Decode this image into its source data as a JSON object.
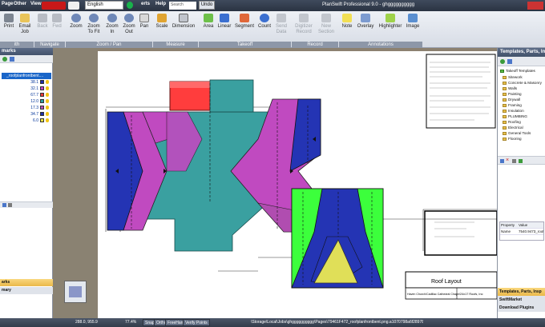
{
  "titlebar": {
    "menu": [
      "Page",
      "Other",
      "View",
      "erts",
      "Help"
    ],
    "language": "English",
    "search_placeholder": "Search",
    "undo_label": "Undo",
    "app_title": "PlanSwift Professional 9.0 - ghgggggggggg"
  },
  "ribbon": {
    "buttons": {
      "print": "Print",
      "email": "Email Job",
      "back": "Back",
      "fwd": "Fwd",
      "zoom": "Zoom",
      "zoom_fit": "Zoom To Fit",
      "zoom_in": "Zoom In",
      "zoom_out": "Zoom Out",
      "pan": "Pan",
      "scale": "Scale",
      "dimension": "Dimension",
      "area": "Area",
      "linear": "Linear",
      "segment": "Segment",
      "count": "Count",
      "send_data": "Send Data",
      "digitizer": "Digitizer Record",
      "new_section": "New Section",
      "note": "Note",
      "overlay": "Overlay",
      "highlighter": "Highlighter",
      "image": "Image"
    },
    "groups": {
      "print": "ith",
      "navigate": "Navigate",
      "zoom_pan": "Zoom / Pan",
      "measure": "Measure",
      "takeoff": "Takeoff",
      "record": "Record",
      "annotations": "Annotations"
    }
  },
  "left_panel": {
    "title": "marks",
    "tree_root": "_roofplanfrontbent....",
    "rows": [
      {
        "value": "38.1",
        "color": "#1e2ca6"
      },
      {
        "value": "32.1",
        "color": "#c040c0"
      },
      {
        "value": "67.7",
        "color": "#e63a3a"
      },
      {
        "value": "12.0",
        "color": "#2da0a0"
      },
      {
        "value": "17.3",
        "color": "#b04db0"
      },
      {
        "value": "34.7",
        "color": "#1e2ca6"
      },
      {
        "value": "6.0",
        "color": "#e8e040"
      }
    ],
    "tab_marks": "arks",
    "tab_summary": "mary"
  },
  "drawing": {
    "title_block": "Roof Layout",
    "block_left": "Haven Church/Cadillac Cathedral Chapel",
    "block_right": "24x17 Roofs, Inc"
  },
  "right_panel": {
    "title": "Templates, Parts, Inst",
    "root": "Takeoff Templates",
    "items": [
      "Sitework",
      "Concrete & Masonry",
      "Walls",
      "Painting",
      "Drywall",
      "Framing",
      "Insulation",
      "PLUMBING",
      "Roofing",
      "Electrical",
      "General Tools",
      "Flooring"
    ],
    "property_header": "Property",
    "value_header": "Value",
    "name_label": "Name",
    "name_value": "7540.9473_roof",
    "tab_templates": "Templates, Parts, Insp",
    "tab_swiftmarket": "SwiftMarket",
    "tab_download": "Download Plugins"
  },
  "statusbar": {
    "coords": "288.0, 955.9",
    "zoom": "77.4%",
    "snap": "Snap",
    "ortho": "Ortho",
    "freehand": "FreeHand",
    "verify": "Verify Points",
    "path": "\\Storage\\Local\\Jobs\\ghgggggggggg\\Pages\\79461F472_roofplanfrontbent.png.a1070798a6f2897827bcd7abba33f0"
  },
  "colors": {
    "blue_roof": "#2434b4",
    "magenta_roof": "#c04ac0",
    "teal_roof": "#3aa0a0",
    "red_roof": "#ff3d3d",
    "green_roof": "#3cff3c",
    "yellow_roof": "#e0df58",
    "title_bg": "#2f3a4b",
    "panel_head": "#4c5b75"
  }
}
